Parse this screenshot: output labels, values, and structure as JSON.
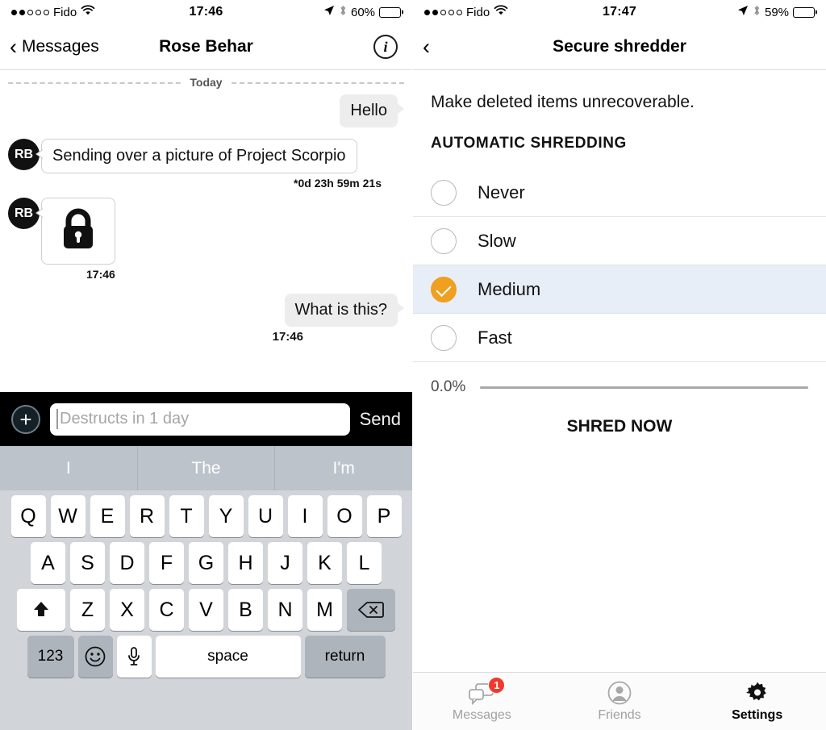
{
  "left": {
    "status": {
      "carrier": "Fido",
      "signal_filled": 2,
      "signal_total": 5,
      "time": "17:46",
      "battery_pct": "60%",
      "battery_level": 60,
      "location_icon": "location-arrow-icon",
      "bluetooth_icon": "bluetooth-icon",
      "wifi_icon": "wifi-icon"
    },
    "nav": {
      "back_label": "Messages",
      "title": "Rose Behar",
      "info_glyph": "i"
    },
    "chat": {
      "day_separator": "Today",
      "messages": [
        {
          "id": "m1",
          "dir": "out",
          "text": "Hello",
          "meta": ""
        },
        {
          "id": "m2",
          "dir": "in",
          "avatar": "RB",
          "text": "Sending over a picture of Project Scorpio",
          "meta": "*0d 23h 59m 21s"
        },
        {
          "id": "m3",
          "dir": "in",
          "avatar": "RB",
          "type": "image",
          "icon": "lock-icon",
          "meta": "17:46"
        },
        {
          "id": "m4",
          "dir": "out",
          "text": "What is this?",
          "meta": "17:46"
        }
      ]
    },
    "input": {
      "add_glyph": "+",
      "placeholder": "Destructs in 1 day",
      "value": "",
      "send_label": "Send"
    },
    "keyboard": {
      "suggestions": [
        "I",
        "The",
        "I'm"
      ],
      "row1": [
        "Q",
        "W",
        "E",
        "R",
        "T",
        "Y",
        "U",
        "I",
        "O",
        "P"
      ],
      "row2": [
        "A",
        "S",
        "D",
        "F",
        "G",
        "H",
        "J",
        "K",
        "L"
      ],
      "row3": [
        "Z",
        "X",
        "C",
        "V",
        "B",
        "N",
        "M"
      ],
      "shift_icon": "shift-icon",
      "backspace_icon": "backspace-icon",
      "numbers_label": "123",
      "emoji_icon": "emoji-icon",
      "mic_icon": "microphone-icon",
      "space_label": "space",
      "return_label": "return"
    }
  },
  "right": {
    "status": {
      "carrier": "Fido",
      "signal_filled": 2,
      "signal_total": 5,
      "time": "17:47",
      "battery_pct": "59%",
      "battery_level": 59,
      "location_icon": "location-arrow-icon",
      "bluetooth_icon": "bluetooth-icon",
      "wifi_icon": "wifi-icon"
    },
    "nav": {
      "title": "Secure shredder"
    },
    "intro": "Make deleted items unrecoverable.",
    "section_header": "AUTOMATIC SHREDDING",
    "options": [
      {
        "id": "never",
        "label": "Never",
        "selected": false
      },
      {
        "id": "slow",
        "label": "Slow",
        "selected": false
      },
      {
        "id": "medium",
        "label": "Medium",
        "selected": true
      },
      {
        "id": "fast",
        "label": "Fast",
        "selected": false
      }
    ],
    "progress": {
      "label": "0.0%",
      "value": 0
    },
    "shred_button": "SHRED NOW",
    "tabs": [
      {
        "id": "messages",
        "label": "Messages",
        "icon": "chat-bubbles-icon",
        "badge": "1",
        "active": false
      },
      {
        "id": "friends",
        "label": "Friends",
        "icon": "person-circle-icon",
        "badge": "",
        "active": false
      },
      {
        "id": "settings",
        "label": "Settings",
        "icon": "gear-icon",
        "badge": "",
        "active": true
      }
    ]
  },
  "colors": {
    "accent_orange": "#F0A020",
    "selected_row": "#E8EEF8",
    "badge_red": "#F03A2E",
    "bubble_out": "#EDEDED",
    "keyboard_bg": "#D1D5DA",
    "suggest_bg": "#BCC3CB"
  }
}
